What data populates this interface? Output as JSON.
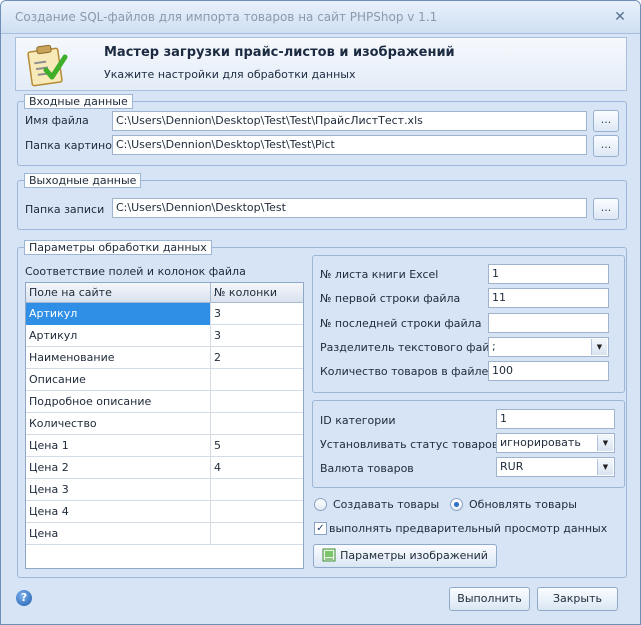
{
  "window": {
    "title": "Создание SQL-файлов для импорта товаров на сайт PHPShop v 1.1",
    "close_glyph": "✕"
  },
  "header": {
    "title": "Мастер загрузки прайс-листов и изображений",
    "subtitle": "Укажите настройки для обработки данных",
    "icon": "checklist-icon"
  },
  "input_data": {
    "legend": "Входные данные",
    "file_label": "Имя файла",
    "file_value": "C:\\Users\\Dennion\\Desktop\\Test\\Test\\ПрайсЛистТест.xls",
    "images_label": "Папка картинок",
    "images_value": "C:\\Users\\Dennion\\Desktop\\Test\\Test\\Pict",
    "browse_label": "..."
  },
  "output_data": {
    "legend": "Выходные данные",
    "folder_label": "Папка записи",
    "folder_value": "C:\\Users\\Dennion\\Desktop\\Test",
    "browse_label": "..."
  },
  "params": {
    "legend": "Параметры обработки данных",
    "mapping_caption": "Соответствие полей и колонок файла",
    "grid": {
      "headers": [
        "Поле на сайте",
        "№ колонки"
      ],
      "rows": [
        {
          "field": "Артикул",
          "col": "3"
        },
        {
          "field": "Артикул",
          "col": "3"
        },
        {
          "field": "Наименование",
          "col": "2"
        },
        {
          "field": "Описание",
          "col": ""
        },
        {
          "field": "Подробное описание",
          "col": ""
        },
        {
          "field": "Количество",
          "col": ""
        },
        {
          "field": "Цена 1",
          "col": "5"
        },
        {
          "field": "Цена 2",
          "col": "4"
        },
        {
          "field": "Цена 3",
          "col": ""
        },
        {
          "field": "Цена 4",
          "col": ""
        },
        {
          "field": "Цена",
          "col": ""
        }
      ],
      "selected_row": 0
    },
    "sheet_label": "№ листа книги Excel",
    "sheet_value": "1",
    "first_row_label": "№ первой строки файла",
    "first_row_value": "11",
    "last_row_label": "№ последней строки файла",
    "last_row_value": "",
    "separator_label": "Разделитель текстового файла",
    "separator_value": ";",
    "count_label": "Количество товаров в файле",
    "count_value": "100",
    "category_label": "ID категории",
    "category_value": "1",
    "status_label": "Установливать статус товаров",
    "status_value": "игнорировать",
    "currency_label": "Валюта товаров",
    "currency_value": "RUR",
    "create_label": "Создавать товары",
    "update_label": "Обновлять товары",
    "mode_selected": "update",
    "preview_label": "выполнять предварительный просмотр данных",
    "preview_checked": true,
    "image_params_label": "Параметры  изображений"
  },
  "footer": {
    "help_glyph": "?",
    "run_label": "Выполнить",
    "close_label": "Закрыть"
  },
  "colors": {
    "window_bg": "#d6e4f5",
    "selection": "#2f8ee6",
    "border": "#9eb6d6"
  }
}
